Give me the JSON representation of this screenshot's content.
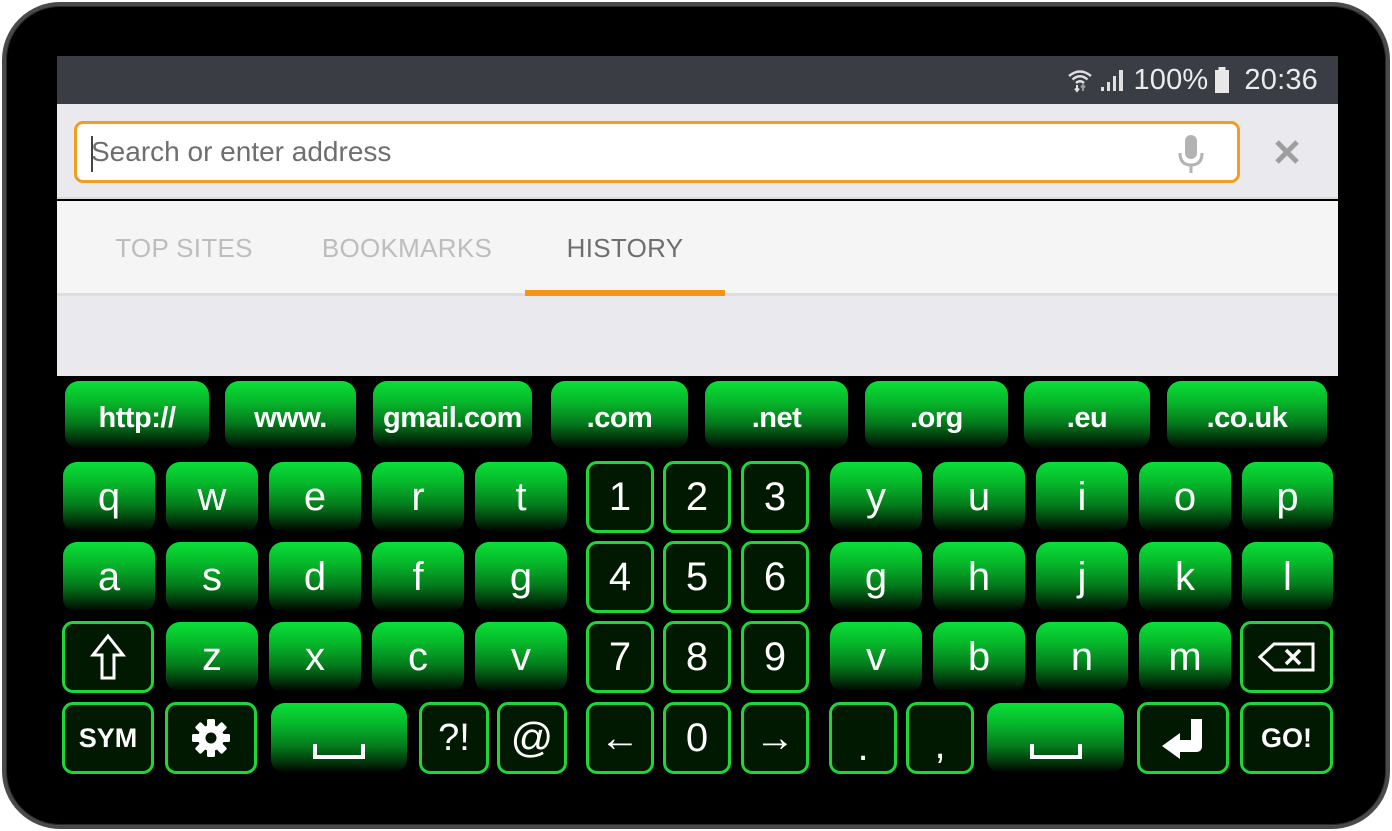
{
  "status_bar": {
    "wifi_icon": "wifi-icon",
    "signal_icon": "signal-icon",
    "battery_text": "100%",
    "battery_icon": "battery-icon",
    "time": "20:36"
  },
  "url_bar": {
    "placeholder": "Search or enter address",
    "value": "",
    "mic_icon": "microphone-icon",
    "close_icon": "close-icon"
  },
  "tabs": [
    {
      "label": "TOP SITES",
      "active": false
    },
    {
      "label": "BOOKMARKS",
      "active": false
    },
    {
      "label": "HISTORY",
      "active": true
    }
  ],
  "keyboard": {
    "accent_color": "#1fd638",
    "shortcut_row": [
      "http://",
      "www.",
      "gmail.com",
      ".com",
      ".net",
      ".org",
      ".eu",
      ".co.uk"
    ],
    "row1_left": [
      "q",
      "w",
      "e",
      "r",
      "t"
    ],
    "row1_digits": [
      "1",
      "2",
      "3"
    ],
    "row1_right": [
      "y",
      "u",
      "i",
      "o",
      "p"
    ],
    "row2_left": [
      "a",
      "s",
      "d",
      "f",
      "g"
    ],
    "row2_digits": [
      "4",
      "5",
      "6"
    ],
    "row2_right": [
      "g",
      "h",
      "j",
      "k",
      "l"
    ],
    "row3_shift_icon": "shift-icon",
    "row3_left": [
      "z",
      "x",
      "c",
      "v"
    ],
    "row3_digits": [
      "7",
      "8",
      "9"
    ],
    "row3_right": [
      "v",
      "b",
      "n",
      "m"
    ],
    "row3_backspace_icon": "backspace-icon",
    "row4": {
      "sym": "SYM",
      "settings_icon": "gear-icon",
      "space_icon": "space-icon",
      "punct": "?!",
      "at": "@",
      "left_arrow": "←",
      "zero": "0",
      "right_arrow": "→",
      "period": ".",
      "comma": ",",
      "enter_icon": "enter-icon",
      "go": "GO!"
    }
  }
}
